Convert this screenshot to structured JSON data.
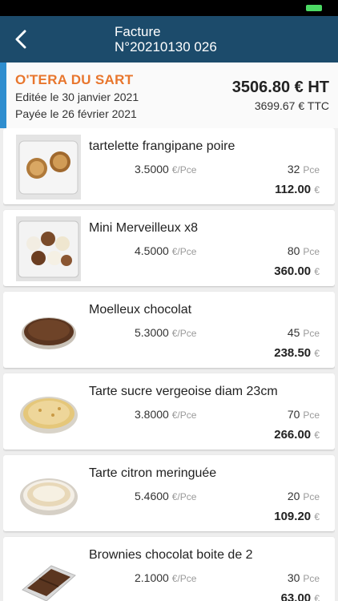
{
  "nav": {
    "title_line1": "Facture",
    "title_line2": "N°20210130 026"
  },
  "invoice": {
    "merchant": "O'TERA DU SART",
    "edit_date": "Editée le 30 janvier 2021",
    "paid_date": "Payée le 26 février 2021",
    "total_ht": "3506.80 € HT",
    "total_ttc": "3699.67 € TTC"
  },
  "units": {
    "price_unit": "€/Pce",
    "qty_unit": "Pce",
    "currency": "€"
  },
  "colors": {
    "nav_bg": "#1c4b6b",
    "accent": "#2e8ecf",
    "merchant": "#e8762d"
  },
  "items": [
    {
      "name": "tartelette frangipane poire",
      "unit_price": "3.5000",
      "qty": "32",
      "total": "112.00",
      "image": "tartelette-photo"
    },
    {
      "name": "Mini Merveilleux x8",
      "unit_price": "4.5000",
      "qty": "80",
      "total": "360.00",
      "image": "merveilleux-photo"
    },
    {
      "name": "Moelleux chocolat",
      "unit_price": "5.3000",
      "qty": "45",
      "total": "238.50",
      "image": "moelleux-photo"
    },
    {
      "name": "Tarte sucre vergeoise diam 23cm",
      "unit_price": "3.8000",
      "qty": "70",
      "total": "266.00",
      "image": "tarte-sucre-photo"
    },
    {
      "name": "Tarte citron meringuée",
      "unit_price": "5.4600",
      "qty": "20",
      "total": "109.20",
      "image": "tarte-citron-photo"
    },
    {
      "name": "Brownies chocolat boite de 2",
      "unit_price": "2.1000",
      "qty": "30",
      "total": "63.00",
      "image": "brownies-photo"
    }
  ]
}
